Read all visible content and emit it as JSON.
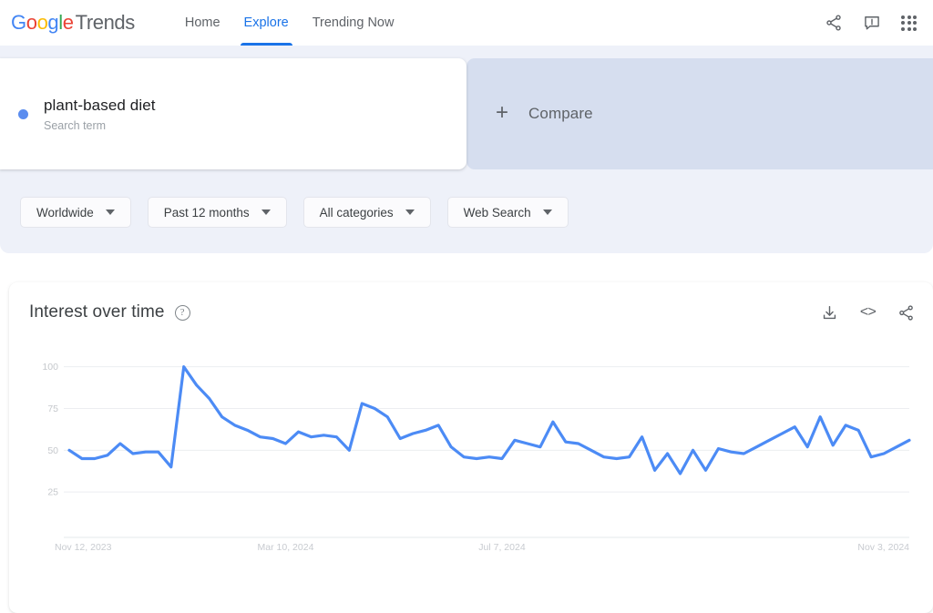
{
  "header": {
    "logo": {
      "google": "Google",
      "trends": "Trends"
    },
    "nav": [
      {
        "label": "Home",
        "active": false
      },
      {
        "label": "Explore",
        "active": true
      },
      {
        "label": "Trending Now",
        "active": false
      }
    ],
    "icons": [
      {
        "name": "share-icon",
        "label": "Share"
      },
      {
        "name": "feedback-icon",
        "label": "Send feedback"
      },
      {
        "name": "apps-grid-icon",
        "label": "Google apps"
      }
    ]
  },
  "query": {
    "term": "plant-based diet",
    "type": "Search term",
    "dot_color": "#5b8def",
    "compare_label": "Compare",
    "compare_plus": "+"
  },
  "filters": [
    {
      "name": "location",
      "value": "Worldwide"
    },
    {
      "name": "time-range",
      "value": "Past 12 months"
    },
    {
      "name": "category",
      "value": "All categories"
    },
    {
      "name": "search-type",
      "value": "Web Search"
    }
  ],
  "chart_card": {
    "title": "Interest over time",
    "help": "?",
    "actions": [
      {
        "name": "download-icon",
        "label": "Download CSV"
      },
      {
        "name": "embed-icon",
        "label": "<>"
      },
      {
        "name": "share-icon",
        "label": "Share"
      }
    ]
  },
  "chart_data": {
    "type": "line",
    "title": "Interest over time",
    "xlabel": "",
    "ylabel": "",
    "ylim": [
      0,
      108
    ],
    "yticks": [
      25,
      50,
      75,
      100
    ],
    "ytick_labels": [
      "25",
      "50",
      "75",
      "100"
    ],
    "grid": true,
    "legend": false,
    "line_color": "#4c8bf5",
    "line_width": 3.2,
    "xtick_labels": [
      "Nov 12, 2023",
      "Mar 10, 2024",
      "Jul 7, 2024",
      "Nov 3, 2024"
    ],
    "xtick_positions": [
      0,
      17,
      34,
      52
    ],
    "series": [
      {
        "name": "plant-based diet",
        "values": [
          50,
          45,
          45,
          47,
          54,
          48,
          49,
          49,
          40,
          100,
          89,
          81,
          70,
          65,
          62,
          58,
          57,
          54,
          61,
          58,
          59,
          58,
          50,
          78,
          75,
          70,
          57,
          60,
          62,
          65,
          52,
          46,
          45,
          46,
          45,
          56,
          54,
          52,
          67,
          55,
          54,
          50,
          46,
          45,
          46,
          58,
          38,
          48,
          36,
          50,
          38,
          51,
          49,
          48,
          52,
          56,
          60,
          64,
          52,
          70,
          53,
          65,
          62,
          46,
          48,
          52,
          56
        ]
      }
    ]
  }
}
